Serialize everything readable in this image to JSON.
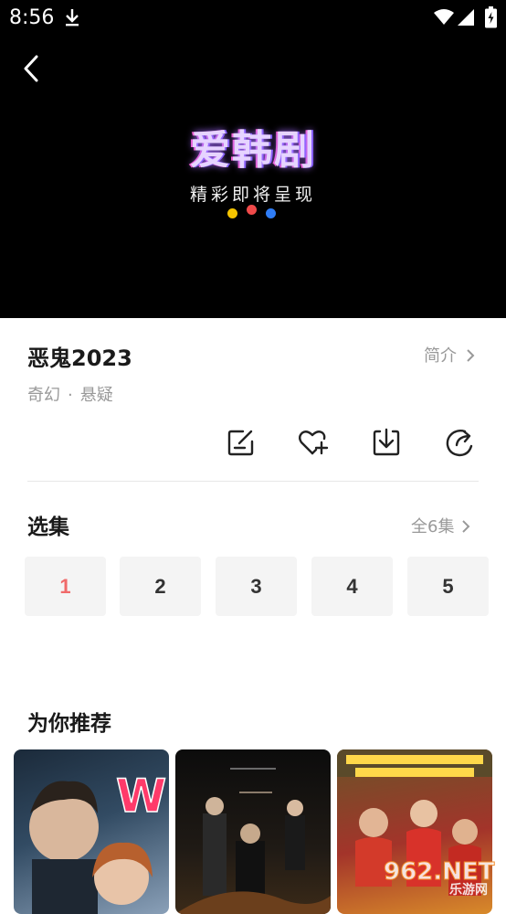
{
  "status_bar": {
    "time": "8:56"
  },
  "player": {
    "logo_title": "爱韩剧",
    "logo_subtitle": "精彩即将呈现",
    "dots": [
      "#f5c400",
      "#f04a4a",
      "#2f7df6"
    ]
  },
  "show": {
    "title": "恶鬼2023",
    "intro_label": "简介",
    "genres": [
      "奇幻",
      "悬疑"
    ],
    "genre_separator": "·"
  },
  "actions": [
    "edit-icon",
    "favorite-add-icon",
    "download-icon",
    "share-icon"
  ],
  "episodes": {
    "title": "选集",
    "all_label": "全6集",
    "items": [
      "1",
      "2",
      "3",
      "4",
      "5"
    ],
    "active_index": 0
  },
  "recommend": {
    "title": "为你推荐",
    "posters": [
      "poster-w",
      "poster-dark-drama",
      "poster-comedy"
    ]
  },
  "watermark": {
    "text": "962.NET",
    "sub": "乐游网"
  }
}
